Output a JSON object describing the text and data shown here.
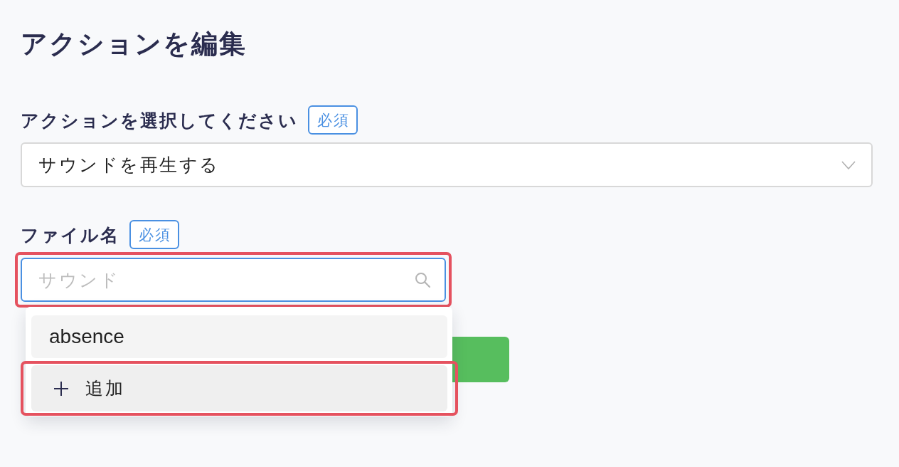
{
  "title": "アクションを編集",
  "fields": [
    {
      "kind": "select",
      "label": "アクションを選択してください",
      "badge": "必須",
      "value": "サウンドを再生する",
      "focused": false
    },
    {
      "kind": "search",
      "label": "ファイル名",
      "badge": "必須",
      "placeholder": "サウンド",
      "focused": true,
      "highlighted": true,
      "dropdown": {
        "options": [
          {
            "kind": "item",
            "label": "absence",
            "highlighted": false
          },
          {
            "kind": "add",
            "label": "追加",
            "highlighted": true
          }
        ]
      }
    }
  ],
  "primary_button": {
    "shown": true
  }
}
